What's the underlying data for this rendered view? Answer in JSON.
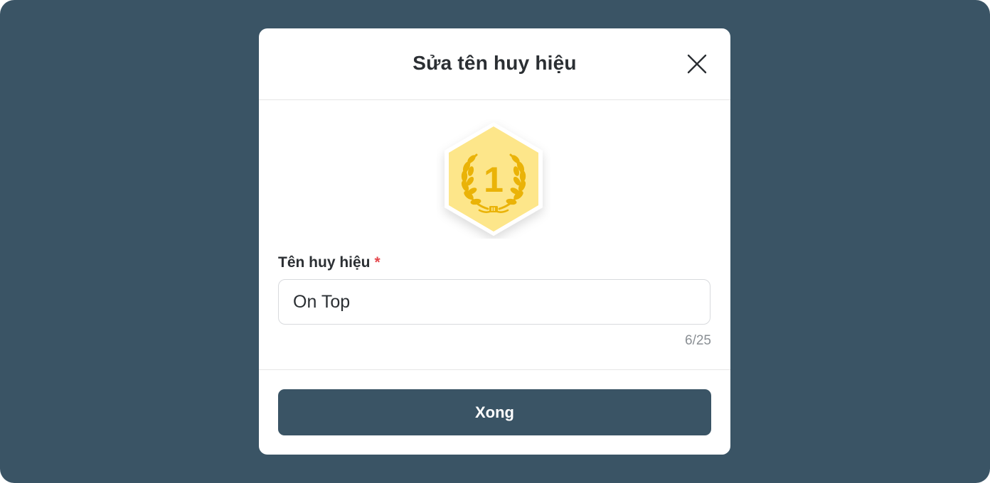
{
  "dialog": {
    "title": "Sửa tên huy hiệu",
    "close_icon": "close-icon"
  },
  "badge": {
    "icon": "laurel-rank-badge-icon",
    "rank_number": "1",
    "colors": {
      "hexagon_fill": "#fde68a",
      "hexagon_border": "#ffffff",
      "emblem": "#eab308"
    }
  },
  "form": {
    "label": "Tên huy hiệu",
    "required_marker": "*",
    "name_value": "On Top",
    "char_count": "6/25"
  },
  "footer": {
    "done_label": "Xong"
  },
  "colors": {
    "backdrop": "#3a5465",
    "primary_button": "#3a5465",
    "required": "#e5484d"
  }
}
